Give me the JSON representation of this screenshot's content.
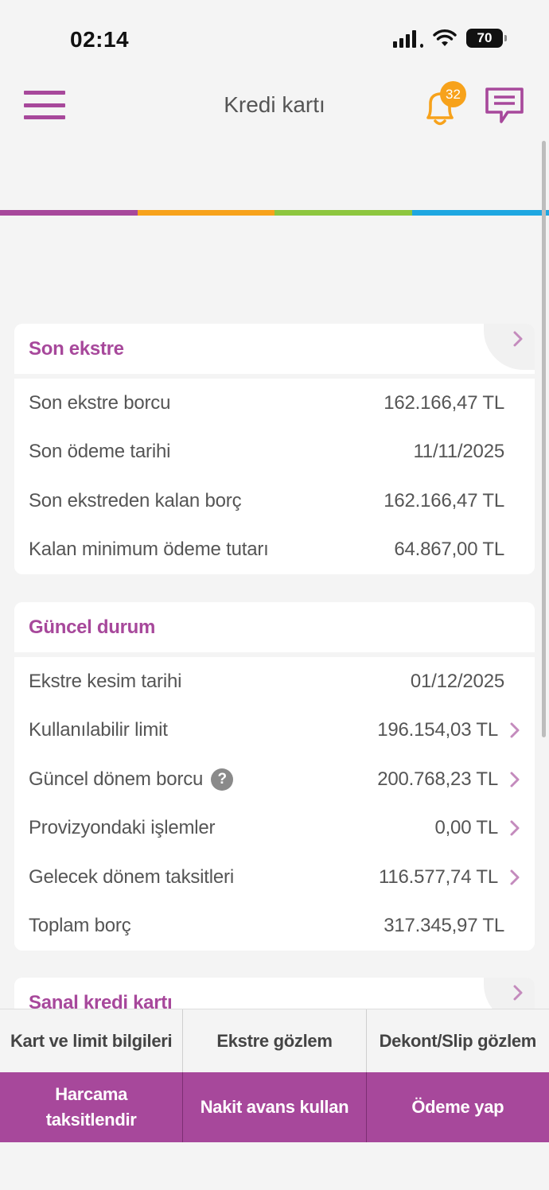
{
  "status_bar": {
    "time": "02:14",
    "battery": "70"
  },
  "header": {
    "title": "Kredi kartı",
    "notification_count": "32"
  },
  "brand_colors": {
    "purple": "#a7489b",
    "orange": "#f7a21b",
    "green": "#8dc63f",
    "blue": "#1ea7e1"
  },
  "son_ekstre": {
    "title": "Son ekstre",
    "rows": [
      {
        "label": "Son ekstre borcu",
        "value": "162.166,47 TL"
      },
      {
        "label": "Son ödeme tarihi",
        "value": "11/11/2025"
      },
      {
        "label": "Son ekstreden kalan borç",
        "value": "162.166,47 TL"
      },
      {
        "label": "Kalan minimum ödeme tutarı",
        "value": "64.867,00 TL"
      }
    ]
  },
  "guncel_durum": {
    "title": "Güncel durum",
    "help_symbol": "?",
    "rows": [
      {
        "label": "Ekstre kesim tarihi",
        "value": "01/12/2025"
      },
      {
        "label": "Kullanılabilir limit",
        "value": "196.154,03 TL"
      },
      {
        "label": "Güncel dönem borcu",
        "value": "200.768,23 TL"
      },
      {
        "label": "Provizyondaki işlemler",
        "value": "0,00 TL"
      },
      {
        "label": "Gelecek dönem taksitleri",
        "value": "116.577,74 TL"
      },
      {
        "label": "Toplam borç",
        "value": "317.345,97 TL"
      }
    ]
  },
  "sanal_kredi": {
    "title": "Sanal kredi kartı"
  },
  "actions": {
    "row1": [
      "Kart ve limit bilgileri",
      "Ekstre gözlem",
      "Dekont/Slip gözlem"
    ],
    "row2": [
      "Harcama taksitlendir",
      "Nakit avans kullan",
      "Ödeme yap"
    ]
  }
}
